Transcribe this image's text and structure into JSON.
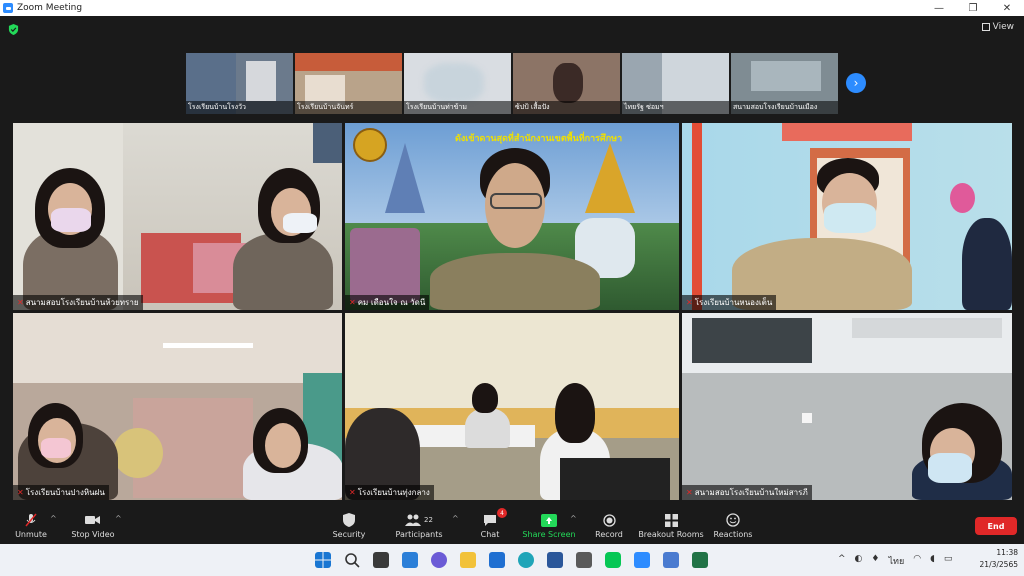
{
  "window": {
    "title": "Zoom Meeting",
    "controls": [
      "—",
      "❐",
      "✕"
    ]
  },
  "meeting": {
    "view_label": "View",
    "thumbnails": [
      {
        "label": "โรงเรียนบ้านโรงวัว"
      },
      {
        "label": "โรงเรียนบ้านจันทร์"
      },
      {
        "label": "โรงเรียนบ้านท่าข้าม"
      },
      {
        "label": "ซ้ปป้ เสื้อปัง"
      },
      {
        "label": "ไทยรัฐ ซ่อมฯ"
      },
      {
        "label": "สนามสอบโรงเรียนบ้านเมือง"
      }
    ],
    "tiles": [
      {
        "label": "สนามสอบโรงเรียนบ้านห้วยทราย"
      },
      {
        "label": "คม เดือนใจ ณ วัดนี"
      },
      {
        "label": "โรงเรียนบ้านหนองเต็น"
      },
      {
        "label": "โรงเรียนบ้านปางหินฝน"
      },
      {
        "label": "โรงเรียนบ้านทุ่งกลาง"
      },
      {
        "label": "สนามสอบโรงเรียนบ้านใหม่สารภี"
      }
    ],
    "banner_text": "ดังเข้าดานสุดที่สำนักงานเขตพื้นที่การศึกษา"
  },
  "toolbar": {
    "unmute": "Unmute",
    "stop_video": "Stop Video",
    "security": "Security",
    "participants": "Participants",
    "participants_count": "22",
    "chat": "Chat",
    "chat_badge": "4",
    "share_screen": "Share Screen",
    "record": "Record",
    "breakout_rooms": "Breakout Rooms",
    "reactions": "Reactions",
    "end": "End"
  },
  "taskbar": {
    "language": "ไทย",
    "time": "11:38",
    "date": "21/3/2565"
  },
  "colors": {
    "accent": "#2d8cff",
    "end": "#e02828",
    "share": "#23d959",
    "active_speaker": "#b4d73c"
  }
}
